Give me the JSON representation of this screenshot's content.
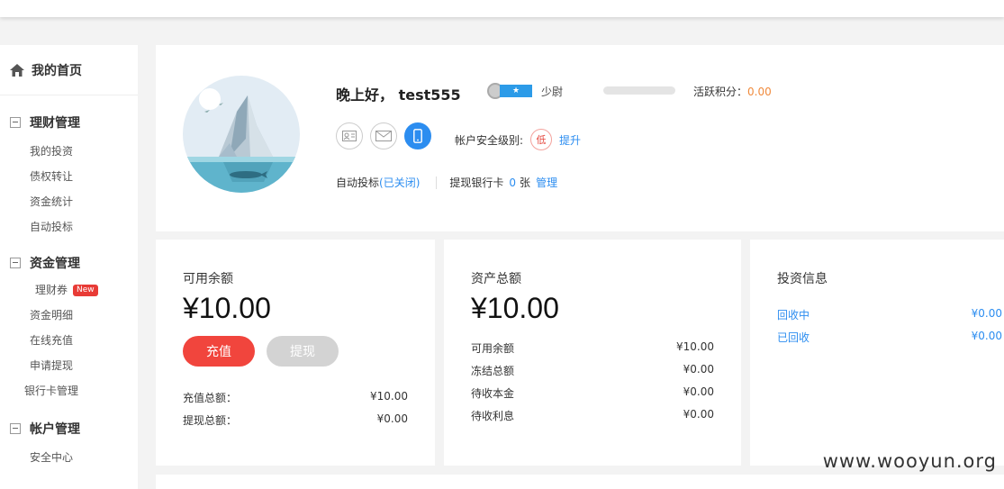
{
  "sidebar": {
    "home": {
      "icon": "home-icon",
      "label": "我的首页"
    },
    "sections": [
      {
        "title": "理财管理",
        "items": [
          {
            "label": "我的投资"
          },
          {
            "label": "债权转让"
          },
          {
            "label": "资金统计"
          },
          {
            "label": "自动投标"
          }
        ]
      },
      {
        "title": "资金管理",
        "items": [
          {
            "label": "理财券",
            "badge": "New"
          },
          {
            "label": "资金明细"
          },
          {
            "label": "在线充值"
          },
          {
            "label": "申请提现"
          },
          {
            "label": "银行卡管理"
          }
        ]
      },
      {
        "title": "帐户管理",
        "items": [
          {
            "label": "安全中心"
          }
        ]
      }
    ]
  },
  "profile": {
    "greeting": "晚上好， test555",
    "rank": {
      "badge_star": "★",
      "label": "少尉"
    },
    "progress_fraction": 0,
    "points_label": "活跃积分：",
    "points_value": "0.00",
    "security_label": "帐户安全级别:",
    "security_level": "低",
    "upgrade_link": "提升",
    "auto_bid_label": "自动投标",
    "auto_bid_status": "(已关闭)",
    "bank_card_label": "提现银行卡",
    "bank_card_count": "0",
    "bank_card_unit": "张",
    "manage_link": "管理"
  },
  "balance_card": {
    "title": "可用余额",
    "amount": "¥10.00",
    "recharge_button": "充值",
    "withdraw_button": "提现",
    "rows": [
      {
        "label": "充值总额：",
        "value": "¥10.00"
      },
      {
        "label": "提现总额：",
        "value": "¥0.00"
      }
    ]
  },
  "assets_card": {
    "title": "资产总额",
    "amount": "¥10.00",
    "rows": [
      {
        "label": "可用余额",
        "value": "¥10.00"
      },
      {
        "label": "冻结总额",
        "value": "¥0.00"
      },
      {
        "label": "待收本金",
        "value": "¥0.00"
      },
      {
        "label": "待收利息",
        "value": "¥0.00"
      }
    ]
  },
  "invest_card": {
    "title": "投资信息",
    "rows": [
      {
        "label": "回收中",
        "value": "¥0.00"
      },
      {
        "label": "已回收",
        "value": "¥0.00"
      }
    ]
  },
  "watermark": "www.wooyun.org",
  "colors": {
    "accent_blue": "#2c8df0",
    "primary_red": "#f1453d",
    "points_orange": "#f08a3c"
  }
}
